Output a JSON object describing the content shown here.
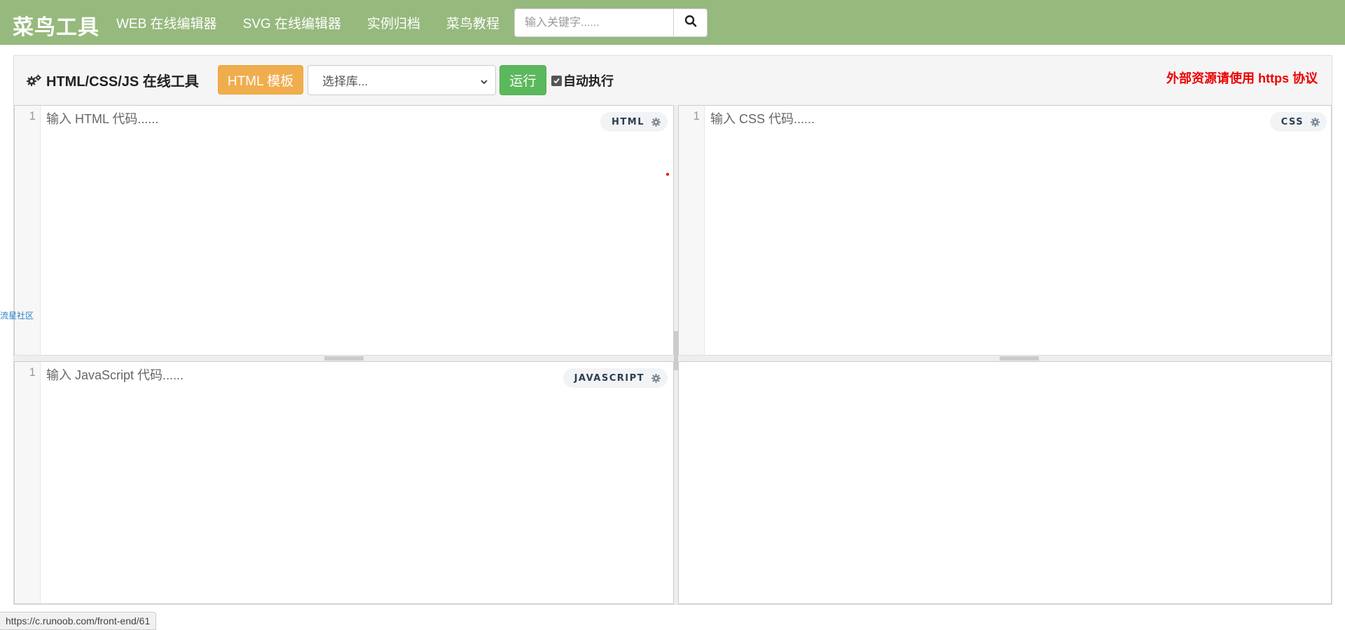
{
  "nav": {
    "logo": "菜鸟工具",
    "links": [
      "WEB 在线编辑器",
      "SVG 在线编辑器",
      "实例归档",
      "菜鸟教程"
    ],
    "search_placeholder": "输入关键字......"
  },
  "toolbar": {
    "title": "HTML/CSS/JS 在线工具",
    "template_button": "HTML 模板",
    "library_select": "选择库...",
    "run_button": "运行",
    "autorun_label": "自动执行",
    "autorun_checked": true,
    "warning": "外部资源请使用 https 协议"
  },
  "editors": {
    "html": {
      "line": "1",
      "placeholder": "输入 HTML 代码......",
      "badge": "HTML"
    },
    "css": {
      "line": "1",
      "placeholder": "输入 CSS 代码......",
      "badge": "CSS"
    },
    "js": {
      "line": "1",
      "placeholder": "输入 JavaScript 代码......",
      "badge": "JAVASCRIPT"
    }
  },
  "side_link": "流星社区",
  "status_url": "https://c.runoob.com/front-end/61",
  "colors": {
    "nav_bg": "#96b97d",
    "template_btn": "#f0ad4e",
    "run_btn": "#5cb85c",
    "warning": "#e00000"
  }
}
